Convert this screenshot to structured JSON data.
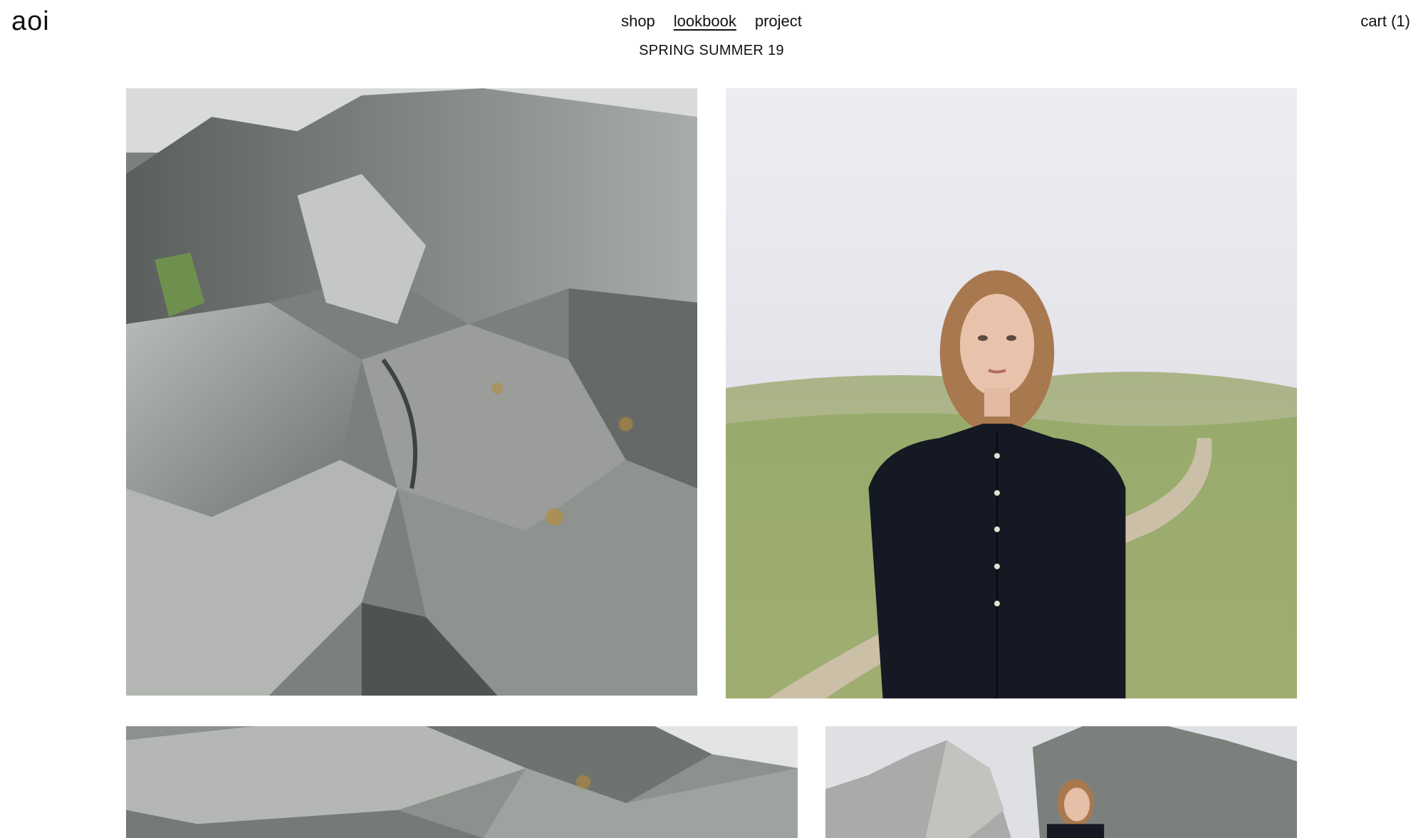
{
  "header": {
    "logo": "aoi",
    "nav": [
      {
        "label": "shop",
        "active": false
      },
      {
        "label": "lookbook",
        "active": true
      },
      {
        "label": "project",
        "active": false
      }
    ],
    "cart_label": "cart (1)"
  },
  "collection": {
    "title": "SPRING SUMMER 19"
  },
  "colors": {
    "background": "#ffffff",
    "text": "#111111",
    "rock": "#8a8f8c",
    "grass": "#8fa866",
    "sky": "#e7e6ec",
    "jacket": "#141821"
  }
}
